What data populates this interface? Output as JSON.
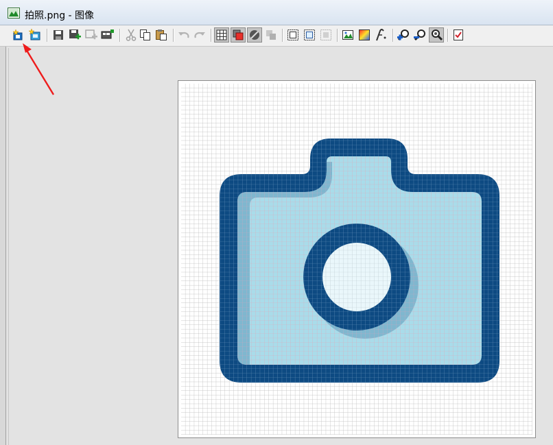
{
  "window": {
    "title": "拍照.png - 图像"
  },
  "toolbar": {
    "buttons": [
      {
        "name": "new-image-button",
        "icon": "new-image-icon",
        "tooltip": ""
      },
      {
        "name": "new-image-alt-button",
        "icon": "new-image-alt-icon"
      },
      {
        "name": "save-button",
        "icon": "save-icon"
      },
      {
        "name": "save-add-button",
        "icon": "save-add-icon"
      },
      {
        "name": "add-frame-button",
        "icon": "add-frame-icon"
      },
      {
        "name": "frames-button",
        "icon": "frames-icon"
      },
      {
        "name": "cut-button",
        "icon": "cut-icon"
      },
      {
        "name": "copy-button",
        "icon": "copy-icon"
      },
      {
        "name": "paste-button",
        "icon": "paste-icon"
      },
      {
        "name": "undo-button",
        "icon": "undo-icon"
      },
      {
        "name": "redo-button",
        "icon": "redo-icon"
      },
      {
        "name": "grid-button",
        "icon": "grid-icon",
        "pressed": true
      },
      {
        "name": "transparent-color-button",
        "icon": "transparent-color-icon",
        "pressed": true
      },
      {
        "name": "background-color-button",
        "icon": "background-color-icon",
        "pressed": true
      },
      {
        "name": "layers-button",
        "icon": "layers-icon"
      },
      {
        "name": "select-all-button",
        "icon": "select-all-icon"
      },
      {
        "name": "select-frame-button",
        "icon": "select-frame-icon"
      },
      {
        "name": "crop-button",
        "icon": "crop-icon"
      },
      {
        "name": "image-properties-button",
        "icon": "image-properties-icon"
      },
      {
        "name": "color-palette-button",
        "icon": "color-palette-icon"
      },
      {
        "name": "effects-button",
        "icon": "effects-icon"
      },
      {
        "name": "zoom-in-button",
        "icon": "zoom-in-icon"
      },
      {
        "name": "zoom-out-button",
        "icon": "zoom-out-icon"
      },
      {
        "name": "zoom-actual-button",
        "icon": "zoom-actual-icon",
        "pressed": true
      },
      {
        "name": "apply-button",
        "icon": "apply-icon"
      }
    ]
  },
  "canvas": {
    "image": "camera-icon",
    "grid": true,
    "colors": {
      "outline": "#0d4a82",
      "body_fill": "#a9dcea",
      "shadow": "#7fb7cf",
      "lens_center": "#eaf7fb",
      "grid_line": "#b9b9b9",
      "grid_line_on_fill": "#e0a8b8"
    }
  },
  "annotation": {
    "color": "#ee1c1c",
    "points_to": "new-image-button"
  }
}
